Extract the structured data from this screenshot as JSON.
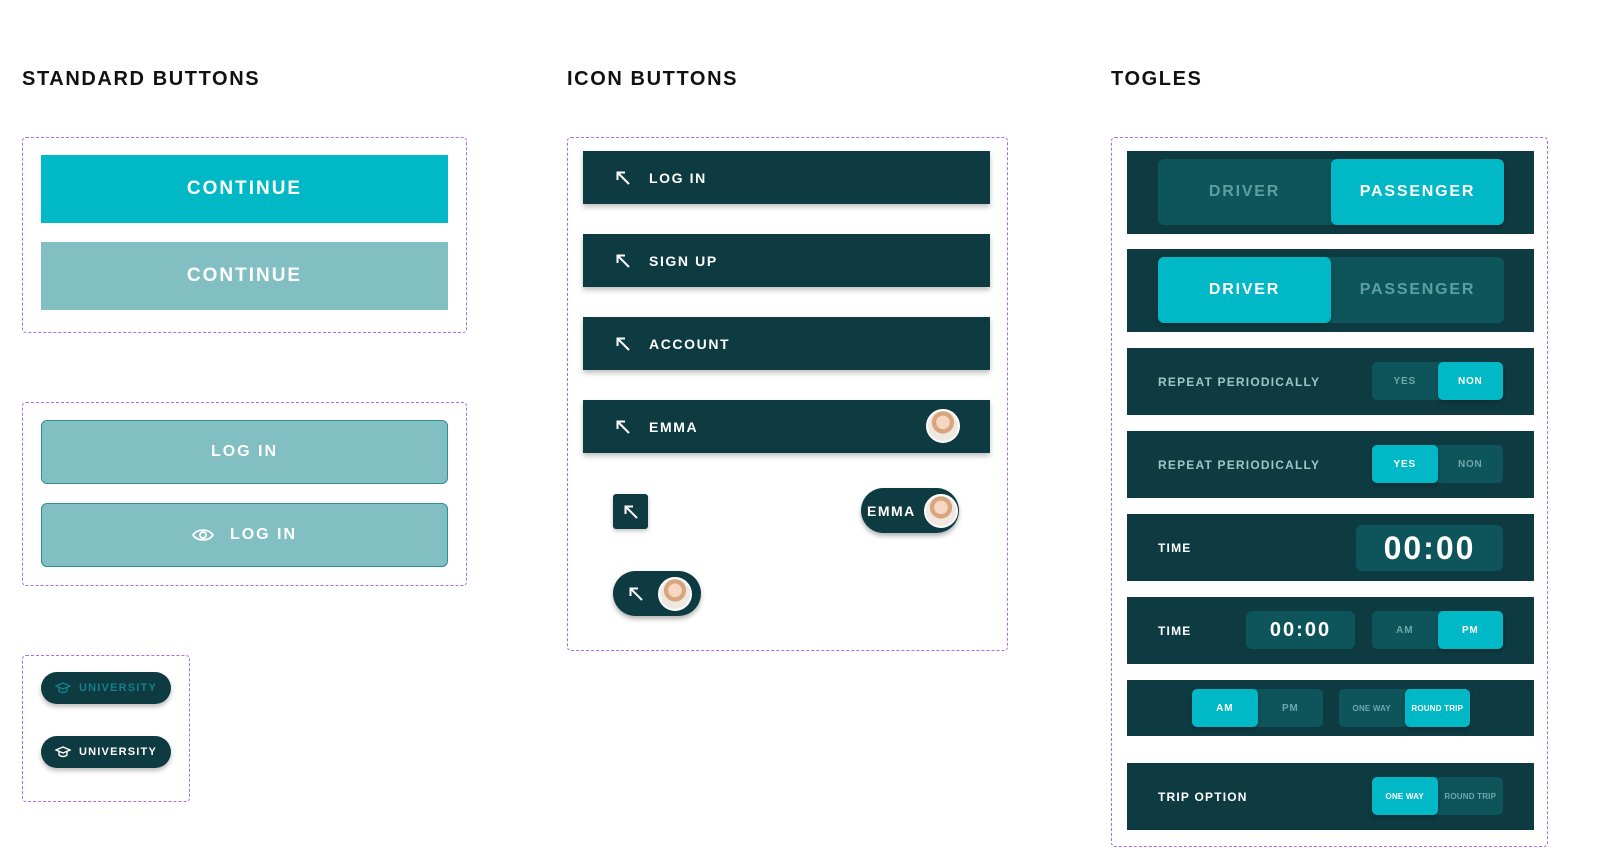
{
  "sections": {
    "standard": "STANDARD BUTTONS",
    "icon": "ICON BUTTONS",
    "toggles": "TOGLES"
  },
  "standard_buttons": {
    "continue_primary": "CONTINUE",
    "continue_disabled": "CONTINUE",
    "login": "LOG IN",
    "login_icon": "LOG IN"
  },
  "chips": {
    "university_dim": "UNIVERSITY",
    "university_lit": "UNIVERSITY"
  },
  "icon_buttons": {
    "login": "LOG IN",
    "signup": "SIGN UP",
    "account": "ACCOUNT",
    "emma": "EMMA",
    "emma_pill": "EMMA"
  },
  "toggles": {
    "role1": {
      "driver": "DRIVER",
      "passenger": "PASSENGER",
      "selected": "PASSENGER"
    },
    "role2": {
      "driver": "DRIVER",
      "passenger": "PASSENGER",
      "selected": "DRIVER"
    },
    "repeat1": {
      "label": "REPEAT PERIODICALLY",
      "yes": "YES",
      "no": "NON",
      "selected": "NON"
    },
    "repeat2": {
      "label": "REPEAT PERIODICALLY",
      "yes": "YES",
      "no": "NON",
      "selected": "YES"
    },
    "time1": {
      "label": "TIME",
      "value": "00:00"
    },
    "time2": {
      "label": "TIME",
      "value": "00:00",
      "am": "AM",
      "pm": "PM",
      "selected": "PM"
    },
    "combo": {
      "am": "AM",
      "pm": "PM",
      "one_way": "ONE WAY",
      "round_trip": "ROUND TRIP",
      "selected_period": "AM",
      "selected_trip": "ROUND TRIP"
    },
    "trip": {
      "label": "TRIP OPTION",
      "one_way": "ONE WAY",
      "round_trip": "ROUND TRIP",
      "selected": "ONE WAY"
    }
  },
  "colors": {
    "primary": "#00b8c6",
    "dark": "#0e3a41",
    "muted": "#82bfc2",
    "dashed_outline": "#a66cf2"
  },
  "icons": {
    "arrow": "arrow-up-left-icon",
    "eye": "eye-icon",
    "university": "graduation-cap-icon",
    "avatar": "user-avatar"
  }
}
